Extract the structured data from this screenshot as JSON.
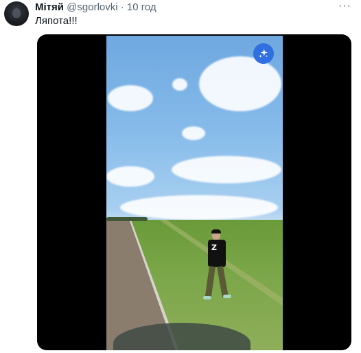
{
  "tweet": {
    "author_name": "Мітяй",
    "author_handle": "@sgorlovki",
    "separator": "·",
    "time": "10 год",
    "text": "Ляпота!!!",
    "more_label": "···"
  },
  "media": {
    "type": "video",
    "ai_icon": "sparkle-icon",
    "accent_color": "#2f6fe0"
  }
}
